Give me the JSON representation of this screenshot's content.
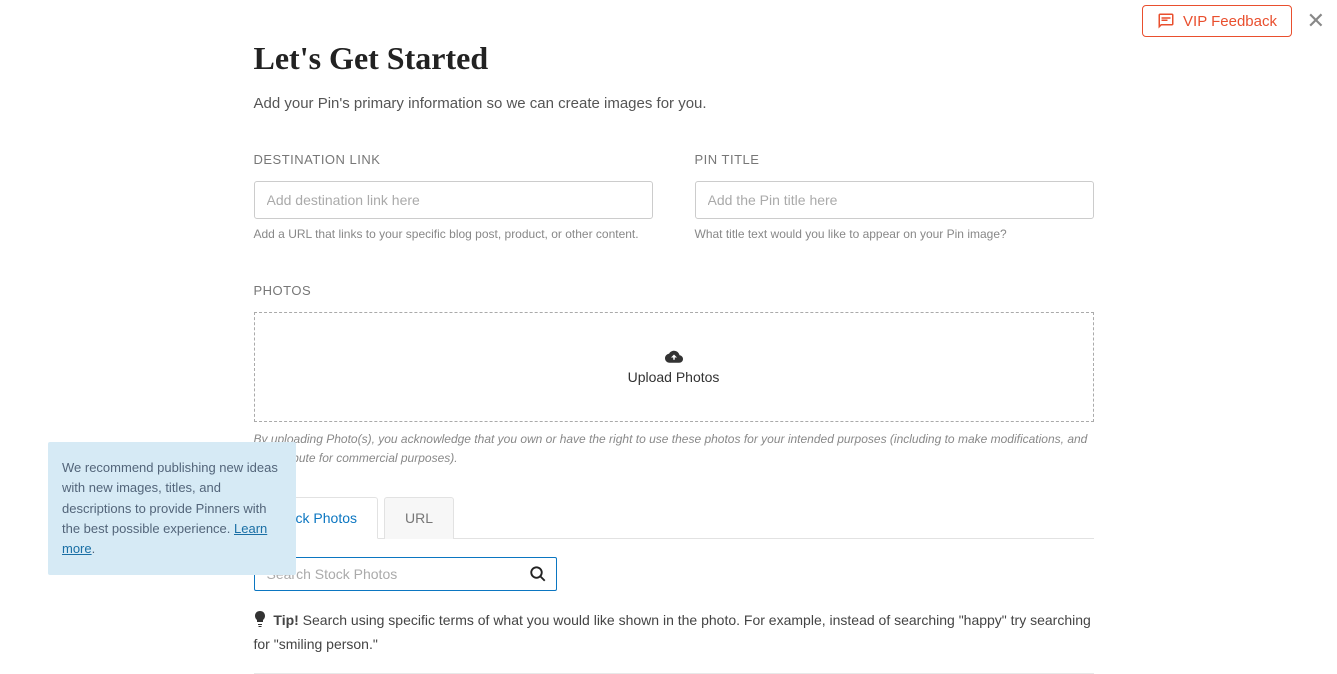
{
  "header": {
    "vip_feedback": "VIP Feedback"
  },
  "page": {
    "title": "Let's Get Started",
    "subtitle": "Add your Pin's primary information so we can create images for you."
  },
  "form": {
    "destination": {
      "label": "DESTINATION LINK",
      "placeholder": "Add destination link here",
      "helper": "Add a URL that links to your specific blog post, product, or other content."
    },
    "pin_title": {
      "label": "PIN TITLE",
      "placeholder": "Add the Pin title here",
      "helper": "What title text would you like to appear on your Pin image?"
    }
  },
  "photos": {
    "label": "PHOTOS",
    "upload_text": "Upload Photos",
    "disclaimer": "By uploading Photo(s), you acknowledge that you own or have the right to use these photos for your intended purposes (including to make modifications, and to distribute for commercial purposes)."
  },
  "tabs": {
    "stock": "Stock Photos",
    "url": "URL"
  },
  "search": {
    "placeholder": "Search Stock Photos"
  },
  "tip": {
    "label": "Tip!",
    "text": " Search using specific terms of what you would like shown in the photo. For example, instead of searching \"happy\" try searching for \"smiling person.\""
  },
  "recommend": {
    "text": "We recommend publishing new ideas with new images, titles, and descriptions to provide Pinners with the best possible experience. ",
    "link": "Learn more"
  }
}
